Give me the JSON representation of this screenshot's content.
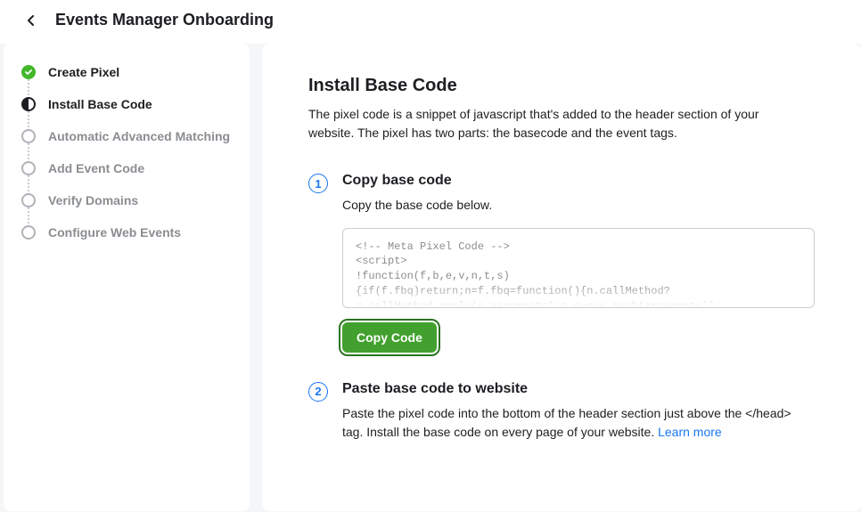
{
  "header": {
    "title": "Events Manager Onboarding"
  },
  "sidebar": {
    "steps": [
      {
        "label": "Create Pixel",
        "state": "done"
      },
      {
        "label": "Install Base Code",
        "state": "current"
      },
      {
        "label": "Automatic Advanced Matching",
        "state": "future"
      },
      {
        "label": "Add Event Code",
        "state": "future"
      },
      {
        "label": "Verify Domains",
        "state": "future"
      },
      {
        "label": "Configure Web Events",
        "state": "future"
      }
    ]
  },
  "main": {
    "title": "Install Base Code",
    "description": "The pixel code is a snippet of javascript that's added to the header section of your website. The pixel has two parts: the basecode and the event tags.",
    "substeps": [
      {
        "num": "1",
        "title": "Copy base code",
        "desc": "Copy the base code below.",
        "code": "<!-- Meta Pixel Code -->\n<script>\n!function(f,b,e,v,n,t,s)\n{if(f.fbq)return;n=f.fbq=function(){n.callMethod?\nn.callMethod.apply(n,arguments):n.queue.push(arguments)};",
        "copy_label": "Copy Code"
      },
      {
        "num": "2",
        "title": "Paste base code to website",
        "desc_prefix": "Paste the pixel code into the bottom of the header section just above the </head> tag. Install the base code on every page of your website. ",
        "learn_more": "Learn more"
      }
    ]
  }
}
